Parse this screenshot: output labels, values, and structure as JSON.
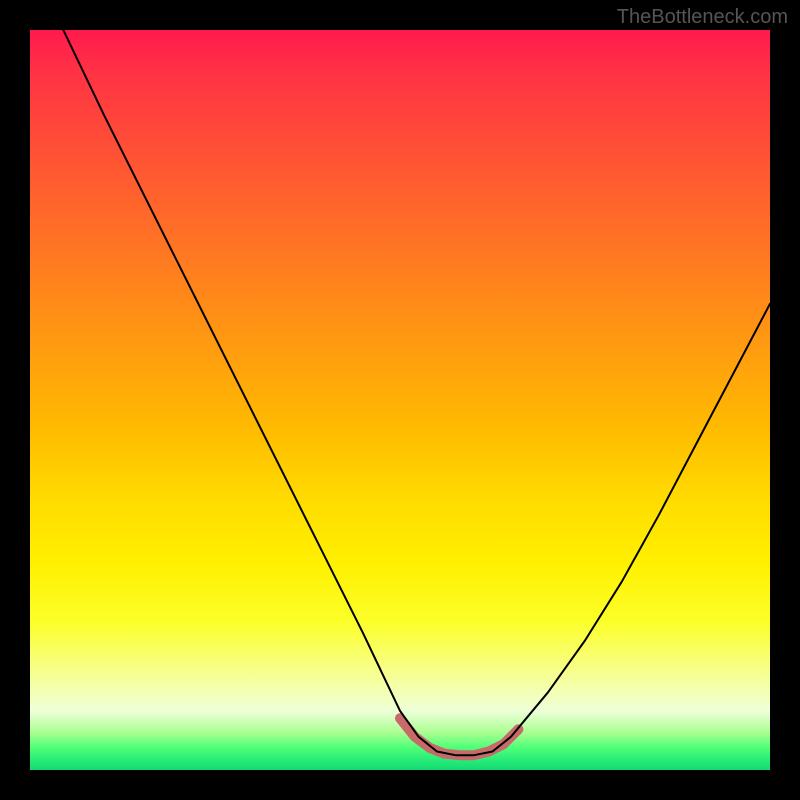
{
  "watermark": "TheBottleneck.com",
  "chart_data": {
    "type": "line",
    "title": "",
    "xlabel": "",
    "ylabel": "",
    "xlim": [
      0,
      1
    ],
    "ylim": [
      0,
      1
    ],
    "series": [
      {
        "name": "bottleneck-curve",
        "x": [
          0.045,
          0.1,
          0.15,
          0.2,
          0.25,
          0.3,
          0.35,
          0.4,
          0.45,
          0.5,
          0.525,
          0.55,
          0.575,
          0.6,
          0.625,
          0.65,
          0.7,
          0.75,
          0.8,
          0.85,
          0.9,
          0.95,
          1.0
        ],
        "y": [
          1.0,
          0.885,
          0.785,
          0.685,
          0.585,
          0.485,
          0.385,
          0.285,
          0.185,
          0.08,
          0.045,
          0.025,
          0.02,
          0.02,
          0.025,
          0.045,
          0.105,
          0.175,
          0.255,
          0.345,
          0.44,
          0.535,
          0.63
        ],
        "color": "#000000",
        "width": 2
      },
      {
        "name": "highlight-band",
        "x": [
          0.5,
          0.52,
          0.54,
          0.56,
          0.58,
          0.6,
          0.62,
          0.64,
          0.66
        ],
        "y": [
          0.07,
          0.045,
          0.03,
          0.022,
          0.02,
          0.02,
          0.025,
          0.035,
          0.055
        ],
        "color": "#c96a6a",
        "width": 10
      }
    ],
    "gradient_stops": [
      {
        "pos": 0.0,
        "color": "#ff1a4d"
      },
      {
        "pos": 0.06,
        "color": "#ff3344"
      },
      {
        "pos": 0.18,
        "color": "#ff5533"
      },
      {
        "pos": 0.3,
        "color": "#ff7722"
      },
      {
        "pos": 0.42,
        "color": "#ff9911"
      },
      {
        "pos": 0.54,
        "color": "#ffbb00"
      },
      {
        "pos": 0.64,
        "color": "#ffdd00"
      },
      {
        "pos": 0.72,
        "color": "#fff000"
      },
      {
        "pos": 0.8,
        "color": "#fcff2a"
      },
      {
        "pos": 0.88,
        "color": "#f5ffa0"
      },
      {
        "pos": 0.92,
        "color": "#eeffd8"
      },
      {
        "pos": 0.95,
        "color": "#a8ff90"
      },
      {
        "pos": 0.97,
        "color": "#4dff78"
      },
      {
        "pos": 0.99,
        "color": "#20e878"
      },
      {
        "pos": 1.0,
        "color": "#18d870"
      }
    ]
  }
}
